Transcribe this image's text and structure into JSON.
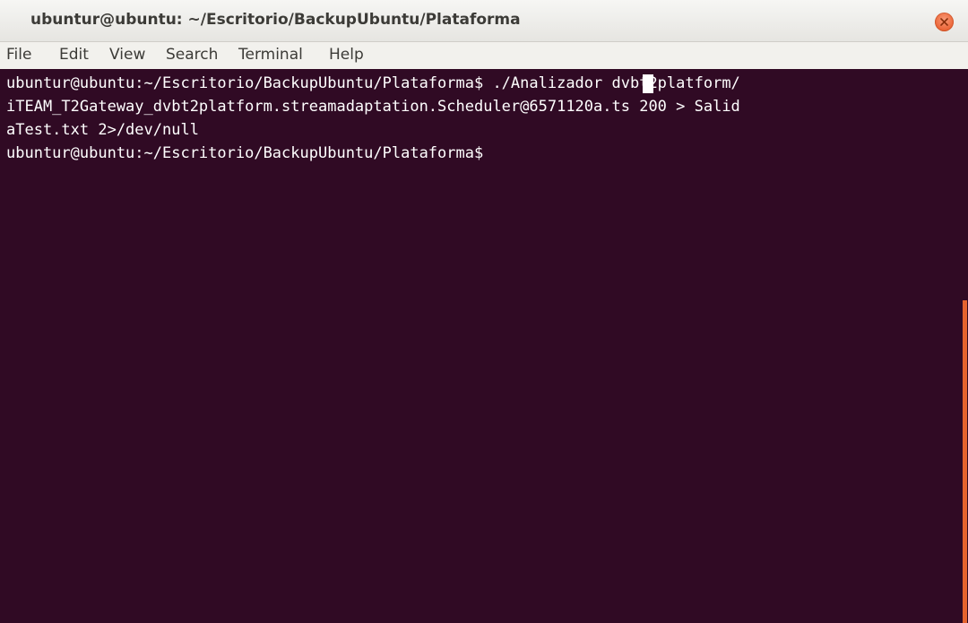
{
  "window": {
    "title": "ubuntur@ubuntu: ~/Escritorio/BackupUbuntu/Plataforma",
    "close_icon": "close-icon"
  },
  "menu": {
    "items": [
      "File",
      "Edit",
      "View",
      "Search",
      "Terminal",
      "Help"
    ]
  },
  "terminal": {
    "lines": [
      "ubuntur@ubuntu:~/Escritorio/BackupUbuntu/Plataforma$ ./Analizador dvbt2platform/",
      "iTEAM_T2Gateway_dvbt2platform.streamadaptation.Scheduler@6571120a.ts 200 > Salid",
      "aTest.txt 2>/dev/null",
      "ubuntur@ubuntu:~/Escritorio/BackupUbuntu/Plataforma$ "
    ]
  },
  "colors": {
    "terminal_background": "#300a24",
    "terminal_text": "#ffffff",
    "close_button": "#ed6b3e",
    "scrollbar": "#e5632e"
  }
}
